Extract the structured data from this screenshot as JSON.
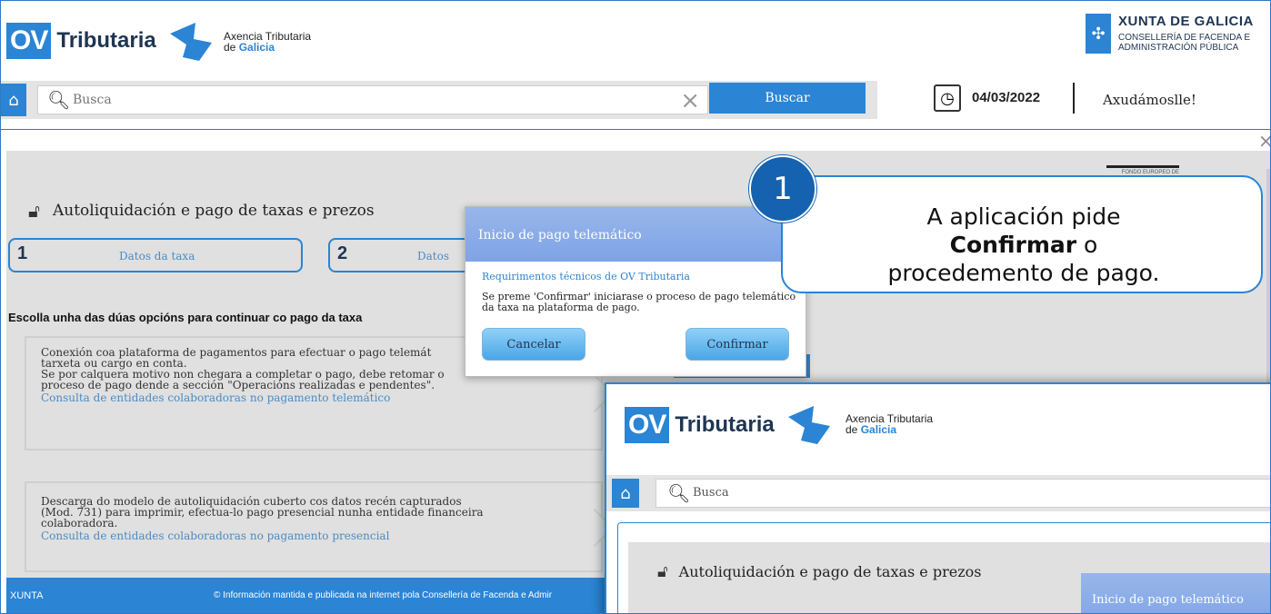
{
  "header": {
    "logo_ov": "OV",
    "logo_tributaria": "Tributaria",
    "agency_line1": "Axencia Tributaria",
    "agency_line2_prefix": "de ",
    "agency_line2_bold": "Galicia",
    "xunta_title": "XUNTA DE GALICIA",
    "xunta_sub1": "CONSELLERÍA DE FACENDA E",
    "xunta_sub2": "ADMINISTRACIÓN PÚBLICA"
  },
  "search": {
    "placeholder": "Busca",
    "button": "Buscar",
    "date": "04/03/2022",
    "help": "Axudámoslle!"
  },
  "main": {
    "fondo_logo": "FONDO EUROPEO DE",
    "title": "Autoliquidación e pago de taxas e prezos",
    "steps": [
      {
        "num": "1",
        "label": "Datos da taxa"
      },
      {
        "num": "2",
        "label": "Datos"
      }
    ],
    "choose": "Escolla unha das dúas opcións para continuar co pago da taxa",
    "option1": {
      "line1": "Conexión coa plataforma de pagamentos para efectuar o pago telemát",
      "line2": "tarxeta ou cargo en conta.",
      "line3": "Se por calquera motivo non chegara a completar o pago, debe retomar o",
      "line4": "proceso de pago dende a sección \"Operacións realizadas e pendentes\".",
      "link": "Consulta de entidades colaboradoras no pagamento telemático"
    },
    "option2": {
      "line1": "Descarga do modelo de autoliquidación cuberto cos datos recén capturados",
      "line2": "(Mod. 731) para imprimir, efectua-lo pago presencial nunha entidade financeira",
      "line3": "colaboradora.",
      "link": "Consulta de entidades colaboradoras no pagamento presencial"
    }
  },
  "footer": {
    "xunta": "XUNTA",
    "text": "© Información mantida e publicada na internet pola Consellería de Facenda e Admir"
  },
  "dialog": {
    "title": "Inicio de pago telemático",
    "requirements": "Requirimentos técnicos de OV Tributaria",
    "message": "Se preme 'Confirmar' iniciarase o proceso de pago telemático da taxa na plataforma de pago.",
    "cancel": "Cancelar",
    "confirm": "Confirmar"
  },
  "callout": {
    "badge": "1",
    "line1": "A aplicación pide",
    "bold": "Confirmar",
    "line2_suffix": " o",
    "line3": "procedemento de pago."
  },
  "inset": {
    "search_placeholder": "Busca",
    "title": "Autoliquidación e pago de taxas e prezos",
    "dialog_title": "Inicio de pago telemático"
  },
  "colors": {
    "accent": "#2b84d4",
    "dialog_header": "#8aaee8",
    "badge": "#1462b0"
  }
}
